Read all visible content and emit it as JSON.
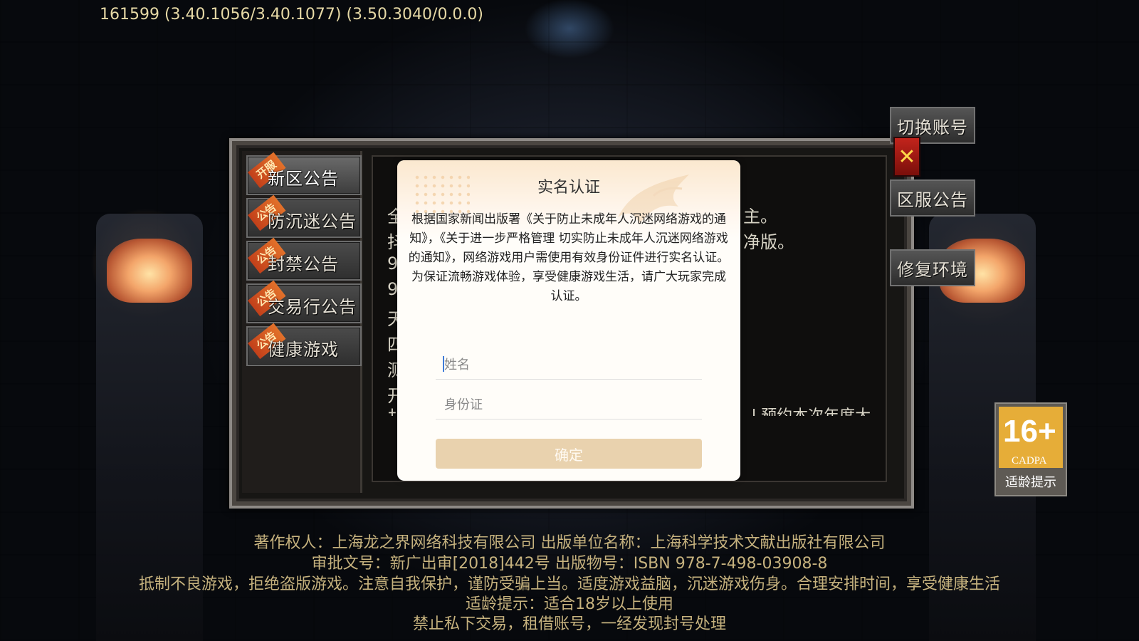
{
  "version_text": "161599 (3.40.1056/3.40.1077) (3.50.3040/0.0.0)",
  "tabs": [
    {
      "ribbon": "开服",
      "label": "新区公告"
    },
    {
      "ribbon": "公告",
      "label": "防沉迷公告"
    },
    {
      "ribbon": "公告",
      "label": "封禁公告"
    },
    {
      "ribbon": "公告",
      "label": "交易行公告"
    },
    {
      "ribbon": "公告",
      "label": "健康游戏"
    }
  ],
  "content_fragments": {
    "left": [
      "全",
      "抖",
      "9",
      "9",
      "天",
      "四",
      "测",
      "开",
      "扌"
    ],
    "right": [
      "主。",
      "净版。"
    ],
    "bottom_right": "l 预约本次年度大"
  },
  "side_buttons": {
    "switch_account": "切换账号",
    "close": "✕",
    "server_notice": "区服公告",
    "repair": "修复环境"
  },
  "age_badge": {
    "number": "16+",
    "org": "CADPA",
    "tip": "适龄提示"
  },
  "modal": {
    "title": "实名认证",
    "text": "根据国家新闻出版署《关于防止未成年人沉迷网络游戏的通知》，《关于进一步严格管理 切实防止未成年人沉迷网络游戏的通知》，网络游戏用户需使用有效身份证件进行实名认证。为保证流畅游戏体验，享受健康游戏生活，请广大玩家完成认证。",
    "name_placeholder": "姓名",
    "id_placeholder": "身份证",
    "confirm_label": "确定"
  },
  "footer": [
    "著作权人：上海龙之界网络科技有限公司 出版单位名称：上海科学技术文献出版社有限公司",
    "审批文号：新广出审[2018]442号 出版物号：ISBN 978-7-498-03908-8",
    "抵制不良游戏，拒绝盗版游戏。注意自我保护，谨防受骗上当。适度游戏益脑，沉迷游戏伤身。合理安排时间，享受健康生活",
    "适龄提示：适合18岁以上使用",
    "禁止私下交易，租借账号，一经发现封号处理"
  ],
  "colors": {
    "footer_text": "#c6b27e",
    "confirm_bg": "#e9d2ae",
    "age_badge": "#e6ad38",
    "close_red": "#c2241c"
  }
}
